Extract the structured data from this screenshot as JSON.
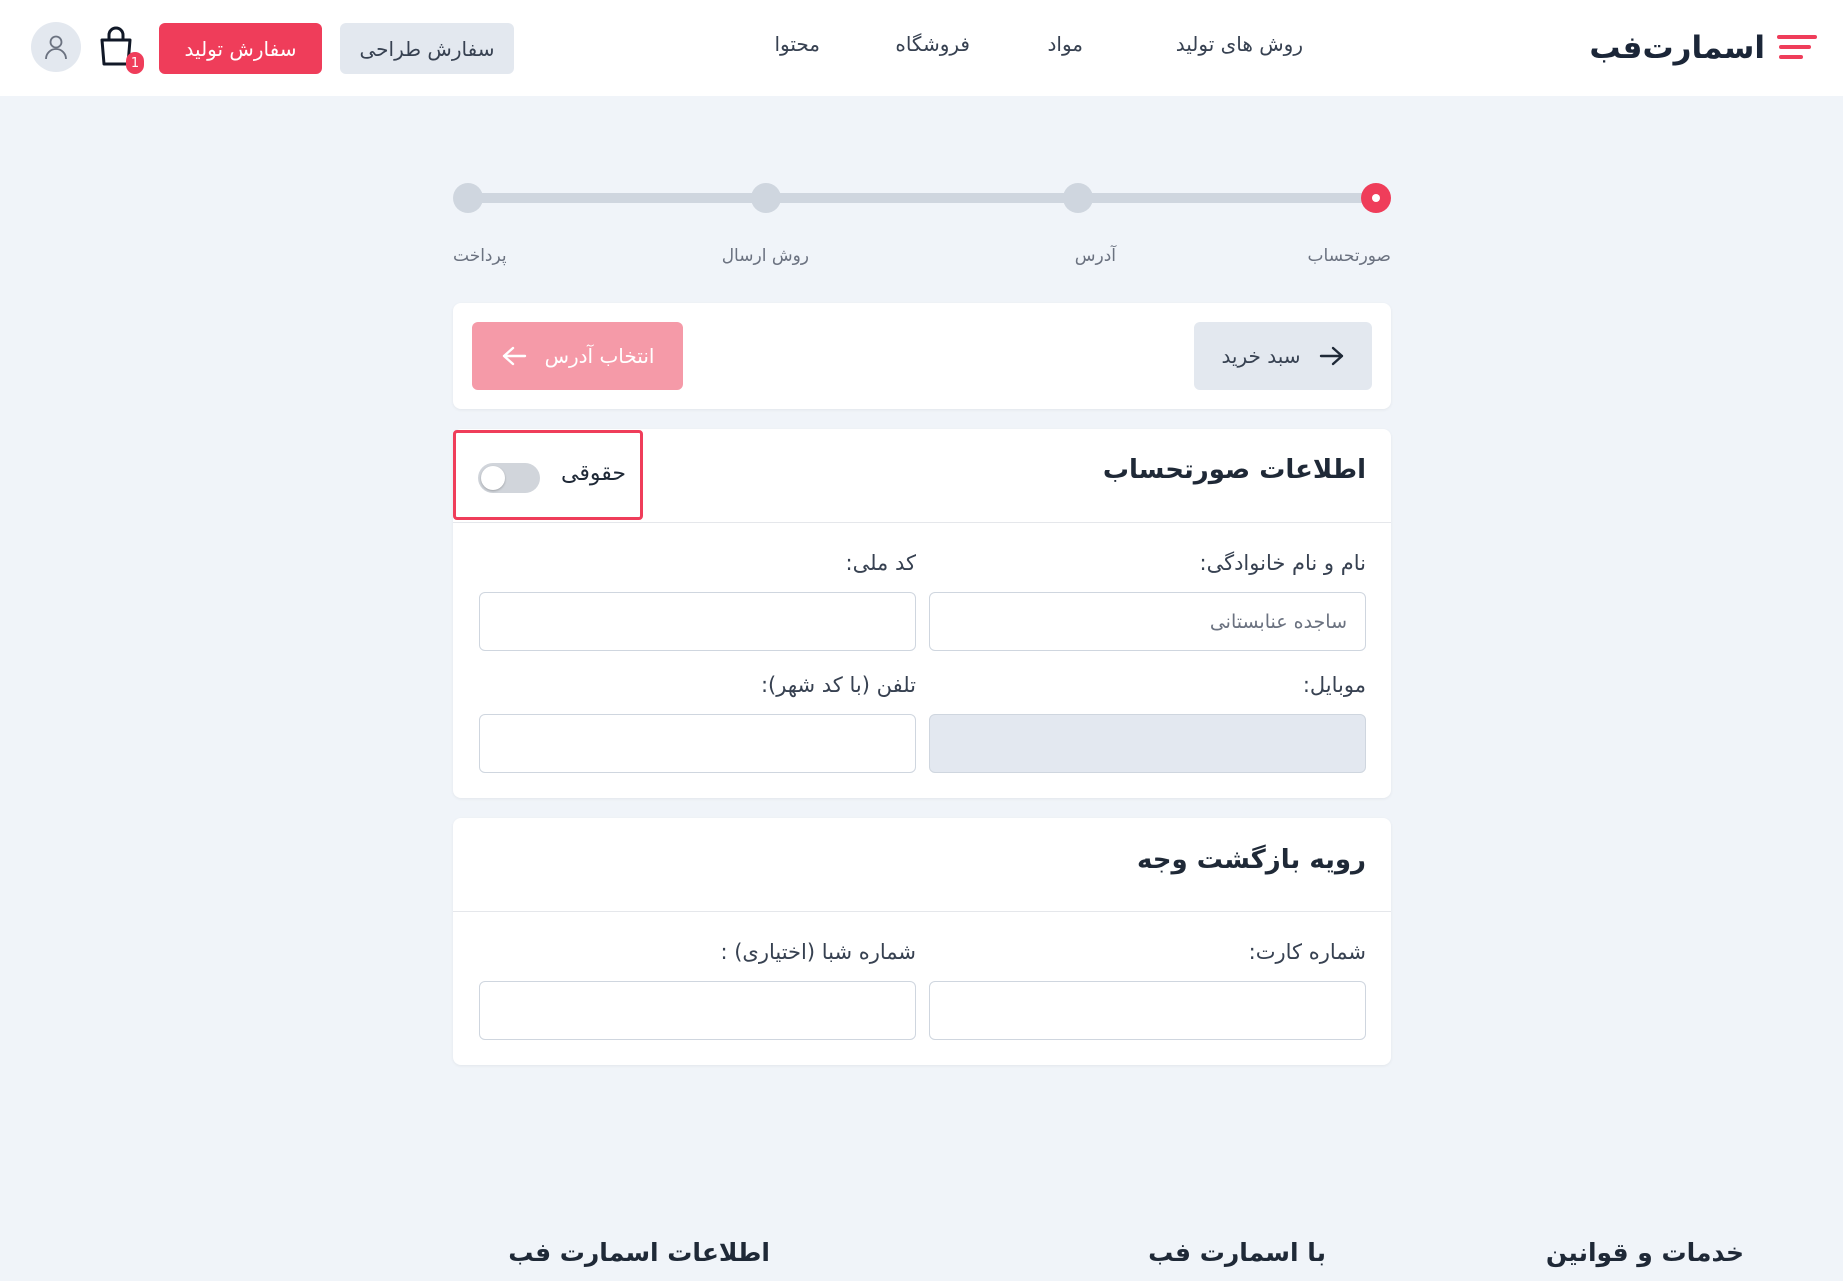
{
  "header": {
    "logo_text": "اسمارت‌فب",
    "nav": [
      {
        "label": "روش های تولید"
      },
      {
        "label": "مواد"
      },
      {
        "label": "فروشگاه"
      },
      {
        "label": "محتوا"
      }
    ],
    "design_order_label": "سفارش طراحی",
    "production_order_label": "سفارش تولید",
    "cart_count": "1",
    "accent_color": "#ef3d5a"
  },
  "stepper": {
    "steps": [
      {
        "label": "صورتحساب",
        "active": true
      },
      {
        "label": "آدرس",
        "active": false
      },
      {
        "label": "روش ارسال",
        "active": false
      },
      {
        "label": "پرداخت",
        "active": false
      }
    ]
  },
  "navigation": {
    "next_label": "انتخاب آدرس",
    "back_label": "سبد خرید"
  },
  "billing": {
    "title": "اطلاعات صورتحساب",
    "legal_toggle_label": "حقوقی",
    "legal_toggle_on": false,
    "full_name_label": "نام و نام خانوادگی:",
    "full_name_value": "ساجده عنابستانی",
    "national_code_label": "کد ملی:",
    "national_code_value": "",
    "mobile_label": "موبایل:",
    "mobile_value": "",
    "phone_label": "تلفن (با کد شهر):",
    "phone_value": ""
  },
  "refund": {
    "title": "رویه بازگشت وجه",
    "card_number_label": "شماره کارت:",
    "card_number_value": "",
    "sheba_label": "شماره شبا (اختیاری) :",
    "sheba_value": ""
  },
  "footer": {
    "col1_title": "خدمات و قوانین",
    "col2_title": "با اسمارت فب",
    "col3_title": "اطلاعات اسمارت فب"
  }
}
